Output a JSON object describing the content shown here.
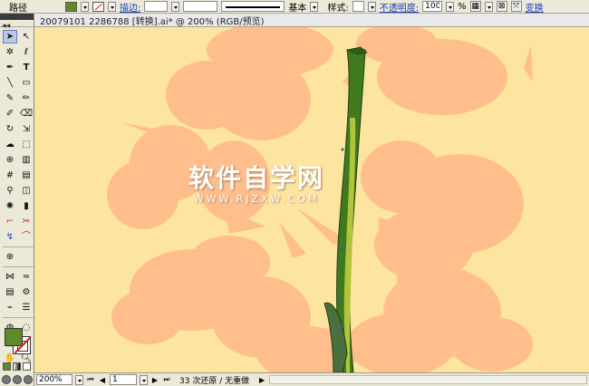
{
  "control_bar": {
    "path_label": "路径",
    "stroke_link": "描边:",
    "stroke_profile": "基本",
    "style_label": "样式:",
    "opacity_link": "不透明度:",
    "opacity_value": "100",
    "opacity_unit": "%",
    "transform_link": "变换",
    "fill_color": "#5f8a2b"
  },
  "document": {
    "title": "20079101 2286788 [转换].ai* @ 200% (RGB/预览)"
  },
  "watermark": {
    "main": "软件自学网",
    "sub": "WWW.RJZXW.COM"
  },
  "status_bar": {
    "zoom": "200%",
    "page": "1",
    "info": "33 次还原 / 无重做"
  },
  "colors": {
    "canvas_bg": "#fde5a0",
    "silhouette": "#ffbe8c",
    "stem_dark": "#3f7a1e",
    "stem_light": "#b2c43a",
    "leaf": "#4a7040"
  }
}
